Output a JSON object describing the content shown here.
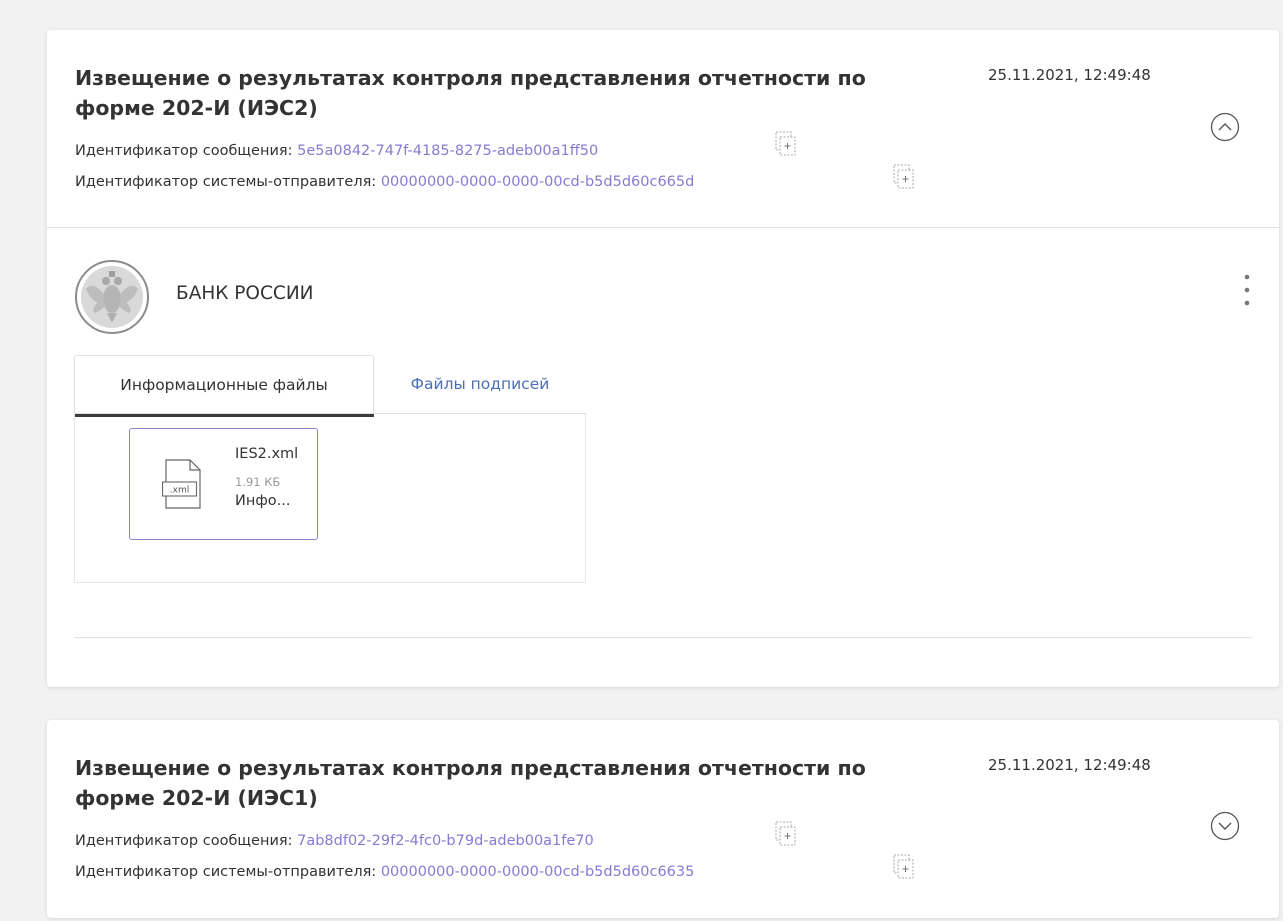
{
  "messages": [
    {
      "title": "Извещение о результатах контроля представления отчетности по форме 202-И (ИЭС2)",
      "date": "25.11.2021, 12:49:48",
      "message_id_label": "Идентификатор сообщения:",
      "message_id": "5e5a0842-747f-4185-8275-adeb00a1ff50",
      "sender_system_label": "Идентификатор системы-отправителя:",
      "sender_system_id": "00000000-0000-0000-00cd-b5d5d60c665d",
      "toggle_icon": "chevron-up-circle-icon",
      "expanded": true,
      "sender": {
        "name": "БАНК РОССИИ",
        "logo": "bank-of-russia-emblem"
      },
      "tabs": [
        {
          "label": "Информационные файлы",
          "active": true
        },
        {
          "label": "Файлы подписей",
          "active": false
        }
      ],
      "files": [
        {
          "name": "IES2.xml",
          "size": "1.91 КБ",
          "type": "Инфо...",
          "icon_label": ".xml",
          "icon": "xml-file-icon"
        }
      ]
    },
    {
      "title": "Извещение о результатах контроля представления отчетности по форме 202-И (ИЭС1)",
      "date": "25.11.2021, 12:49:48",
      "message_id_label": "Идентификатор сообщения:",
      "message_id": "7ab8df02-29f2-4fc0-b79d-adeb00a1fe70",
      "sender_system_label": "Идентификатор системы-отправителя:",
      "sender_system_id": "00000000-0000-0000-00cd-b5d5d60c6635",
      "toggle_icon": "chevron-down-circle-icon",
      "expanded": false
    }
  ],
  "colors": {
    "link_value": "#8a79d3",
    "tab_link": "#4b6fb5",
    "file_border": "#9185d2",
    "background": "#f2f2f2"
  }
}
